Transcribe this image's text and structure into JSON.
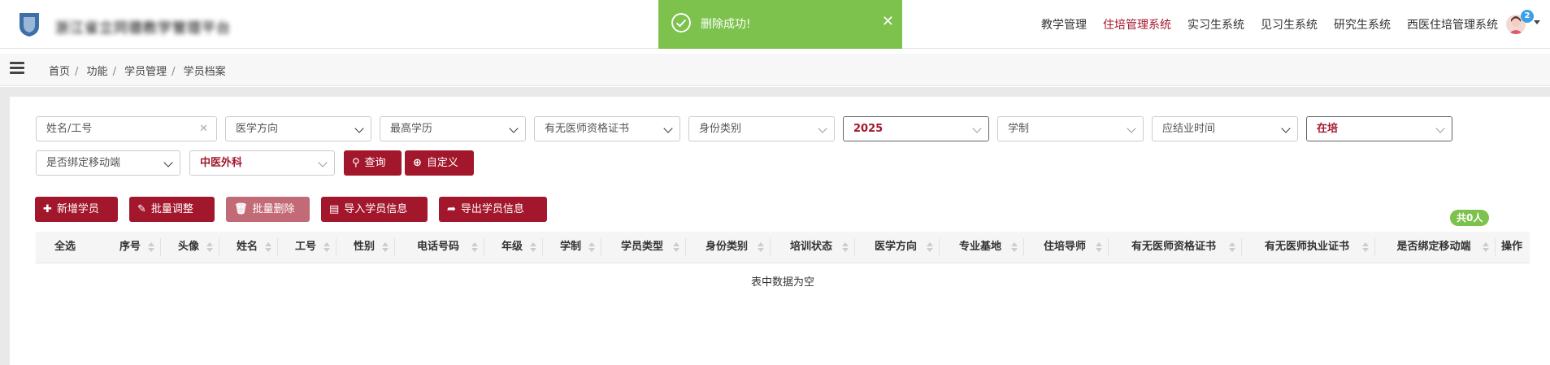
{
  "header": {
    "brand": "浙江省立同德教学管理平台",
    "nav": [
      "教学管理",
      "住培管理系统",
      "实习生系统",
      "见习生系统",
      "研究生系统",
      "西医住培管理系统"
    ],
    "active_nav": "住培管理系统",
    "notification_count": "2"
  },
  "toast": {
    "message": "删除成功!",
    "close_glyph": "✕"
  },
  "breadcrumb": [
    "首页",
    "功能",
    "学员管理",
    "学员档案"
  ],
  "filters": {
    "name_placeholder": "姓名/工号",
    "clear_glyph": "✕",
    "medical_direction": "医学方向",
    "education": "最高学历",
    "physician_cert": "有无医师资格证书",
    "identity_type": "身份类别",
    "year": "2025",
    "program_length": "学制",
    "graduation_time": "应结业时间",
    "training_status": "在培",
    "mobile_bound": "是否绑定移动端",
    "department": "中医外科"
  },
  "buttons": {
    "search": "查询",
    "custom": "自定义",
    "add": "新增学员",
    "batch_adjust": "批量调整",
    "batch_delete": "批量删除",
    "import": "导入学员信息",
    "export": "导出学员信息"
  },
  "total_badge": "共0人",
  "table": {
    "columns": [
      "全选",
      "序号",
      "头像",
      "姓名",
      "工号",
      "性别",
      "电话号码",
      "年级",
      "学制",
      "学员类型",
      "身份类别",
      "培训状态",
      "医学方向",
      "专业基地",
      "住培导师",
      "有无医师资格证书",
      "有无医师执业证书",
      "是否绑定移动端",
      "操作"
    ],
    "empty_text": "表中数据为空"
  },
  "colors": {
    "brand": "#a3172c",
    "success": "#7cc24d",
    "badge": "#3ca0e6"
  }
}
